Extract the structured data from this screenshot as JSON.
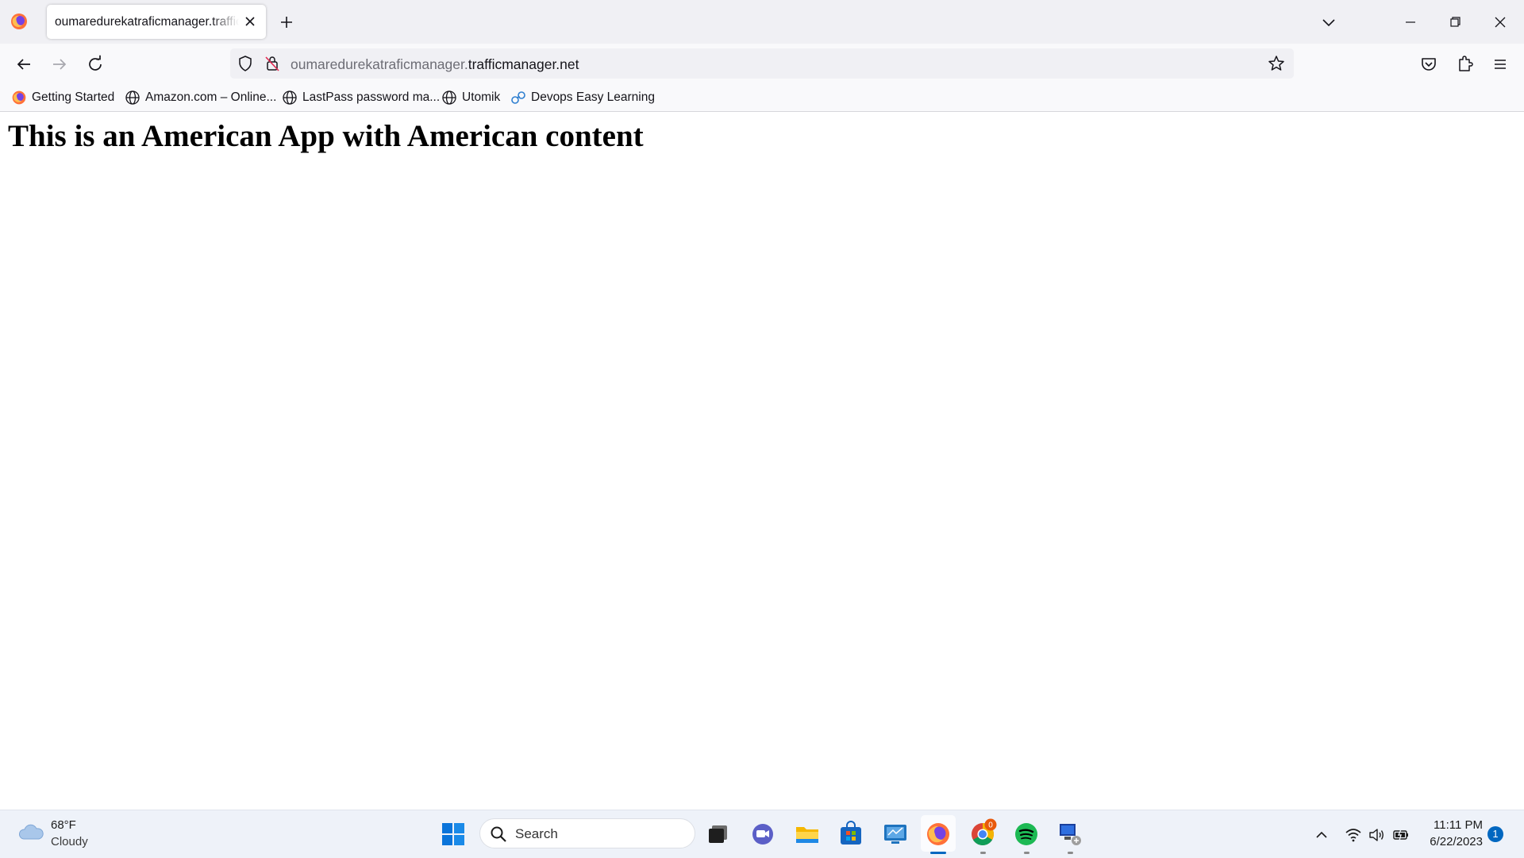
{
  "browser": {
    "tab": {
      "title": "oumaredurekatraficmanager.trafficmanager.net"
    },
    "url": {
      "host_prefix": "oumaredurekatraficmanager.",
      "host_domain": "trafficmanager.net"
    },
    "bookmarks": [
      {
        "label": "Getting Started",
        "icon": "firefox-icon"
      },
      {
        "label": "Amazon.com – Online...",
        "icon": "globe-icon"
      },
      {
        "label": "LastPass password ma...",
        "icon": "globe-icon"
      },
      {
        "label": "Utomik",
        "icon": "globe-icon"
      },
      {
        "label": "Devops Easy Learning",
        "icon": "devops-icon"
      }
    ]
  },
  "page": {
    "heading": "This is an American App with American content"
  },
  "taskbar": {
    "weather": {
      "temp": "68°F",
      "condition": "Cloudy"
    },
    "search_label": "Search",
    "chrome_badge": "0",
    "clock": {
      "time": "11:11 PM",
      "date": "6/22/2023"
    },
    "notification_count": "1"
  },
  "colors": {
    "tab_strip": "#f0f0f4",
    "toolbar": "#f9f9fb",
    "taskbar": "#eef2f9",
    "accent_blue": "#0067c0"
  }
}
